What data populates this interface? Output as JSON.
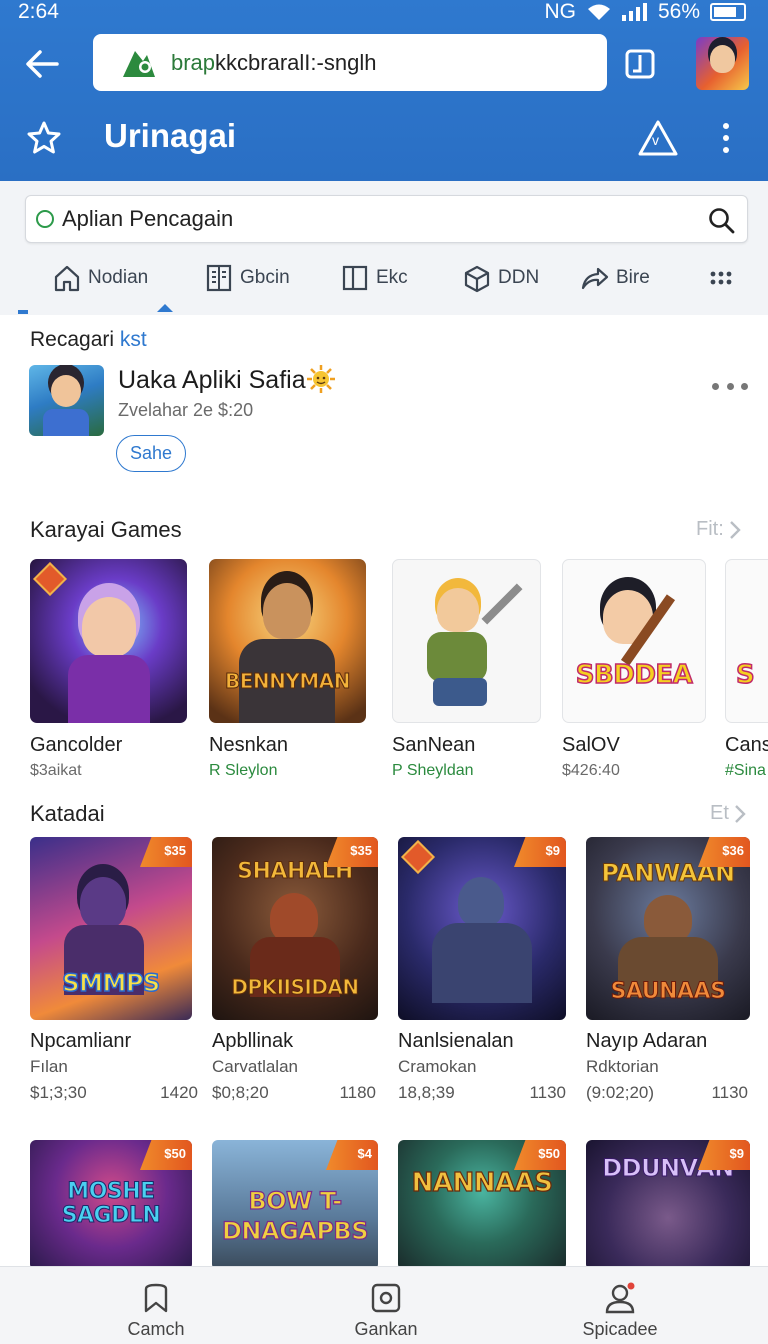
{
  "status_bar": {
    "time": "2:64",
    "network": "NG",
    "battery": "56%"
  },
  "address_bar": {
    "domain_prefix": "brap",
    "domain_rest": "kkcbraralI:-snglh"
  },
  "app_bar": {
    "title": "Urinagai",
    "triangle_label": "v"
  },
  "search": {
    "text": "Aplian Pencagain"
  },
  "category_tabs": [
    {
      "label": "Nodian",
      "icon": "home-icon"
    },
    {
      "label": "Gbcin",
      "icon": "book-icon"
    },
    {
      "label": "Ekc",
      "icon": "card-icon"
    },
    {
      "label": "DDN",
      "icon": "box-icon"
    },
    {
      "label": "Bire",
      "icon": "share-icon"
    },
    {
      "label": "",
      "icon": "grid-dots-icon"
    }
  ],
  "recent": {
    "title": "Recagari",
    "title_accent": "kst",
    "item_name": "Uaka Apliki Safia",
    "item_sub": "Zvelahar 2e $:20",
    "button": "Sahe"
  },
  "games_section": {
    "title": "Karayai Games",
    "more": "Fit:",
    "items": [
      {
        "name": "Gancolder",
        "sub": "$3aikat",
        "sub_green": false,
        "caption": ""
      },
      {
        "name": "Nesnkan",
        "sub": "R Sleylon",
        "sub_green": true,
        "caption": "BENNYMAN"
      },
      {
        "name": "SanNean",
        "sub": "P Sheyldan",
        "sub_green": true,
        "caption": ""
      },
      {
        "name": "SalOV",
        "sub": "$426:40",
        "sub_green": false,
        "caption": "SBDDEA"
      },
      {
        "name": "Cans",
        "sub": "#Sina",
        "sub_green": true,
        "caption": "S"
      }
    ]
  },
  "second_section": {
    "title": "Katadai",
    "more": "Et",
    "items": [
      {
        "name": "Npcamlianr",
        "sub": "Fılan",
        "price": "$1;3;30",
        "count": "1420",
        "badge": "$35",
        "caption": "SMMPS"
      },
      {
        "name": "Apbllinak",
        "sub": "Carvatlalan",
        "price": "$0;8;20",
        "count": "1180",
        "badge": "$35",
        "caption": "DPKIISIDAN",
        "caption_top": "SHAHALH"
      },
      {
        "name": "Nanlsienalan",
        "sub": "Cramokan",
        "price": "18,8;39",
        "count": "1130",
        "badge": "$9",
        "caption": ""
      },
      {
        "name": "Nayıp Adaran",
        "sub": "Rdktorian",
        "price": "(9:02;20)",
        "count": "1130",
        "badge": "$36",
        "caption": "SAUNAAS",
        "caption_top": "PANWAAN"
      }
    ],
    "row2": [
      {
        "badge": "$50",
        "caption": "MOSHE SAGDLN"
      },
      {
        "badge": "$4",
        "caption": "BOW T-DNAGAPBS"
      },
      {
        "badge": "$50",
        "caption": "NANNAAS"
      },
      {
        "badge": "$9",
        "caption": "DDUNVAN"
      }
    ]
  },
  "bottom_nav": [
    {
      "label": "Camch",
      "icon": "bookmark-icon"
    },
    {
      "label": "Gankan",
      "icon": "square-circle-icon"
    },
    {
      "label": "Spicadee",
      "icon": "person-icon"
    }
  ],
  "colors": {
    "primary": "#2f79cf",
    "green": "#2b8a3e",
    "badge_orange": "#e9722a"
  }
}
